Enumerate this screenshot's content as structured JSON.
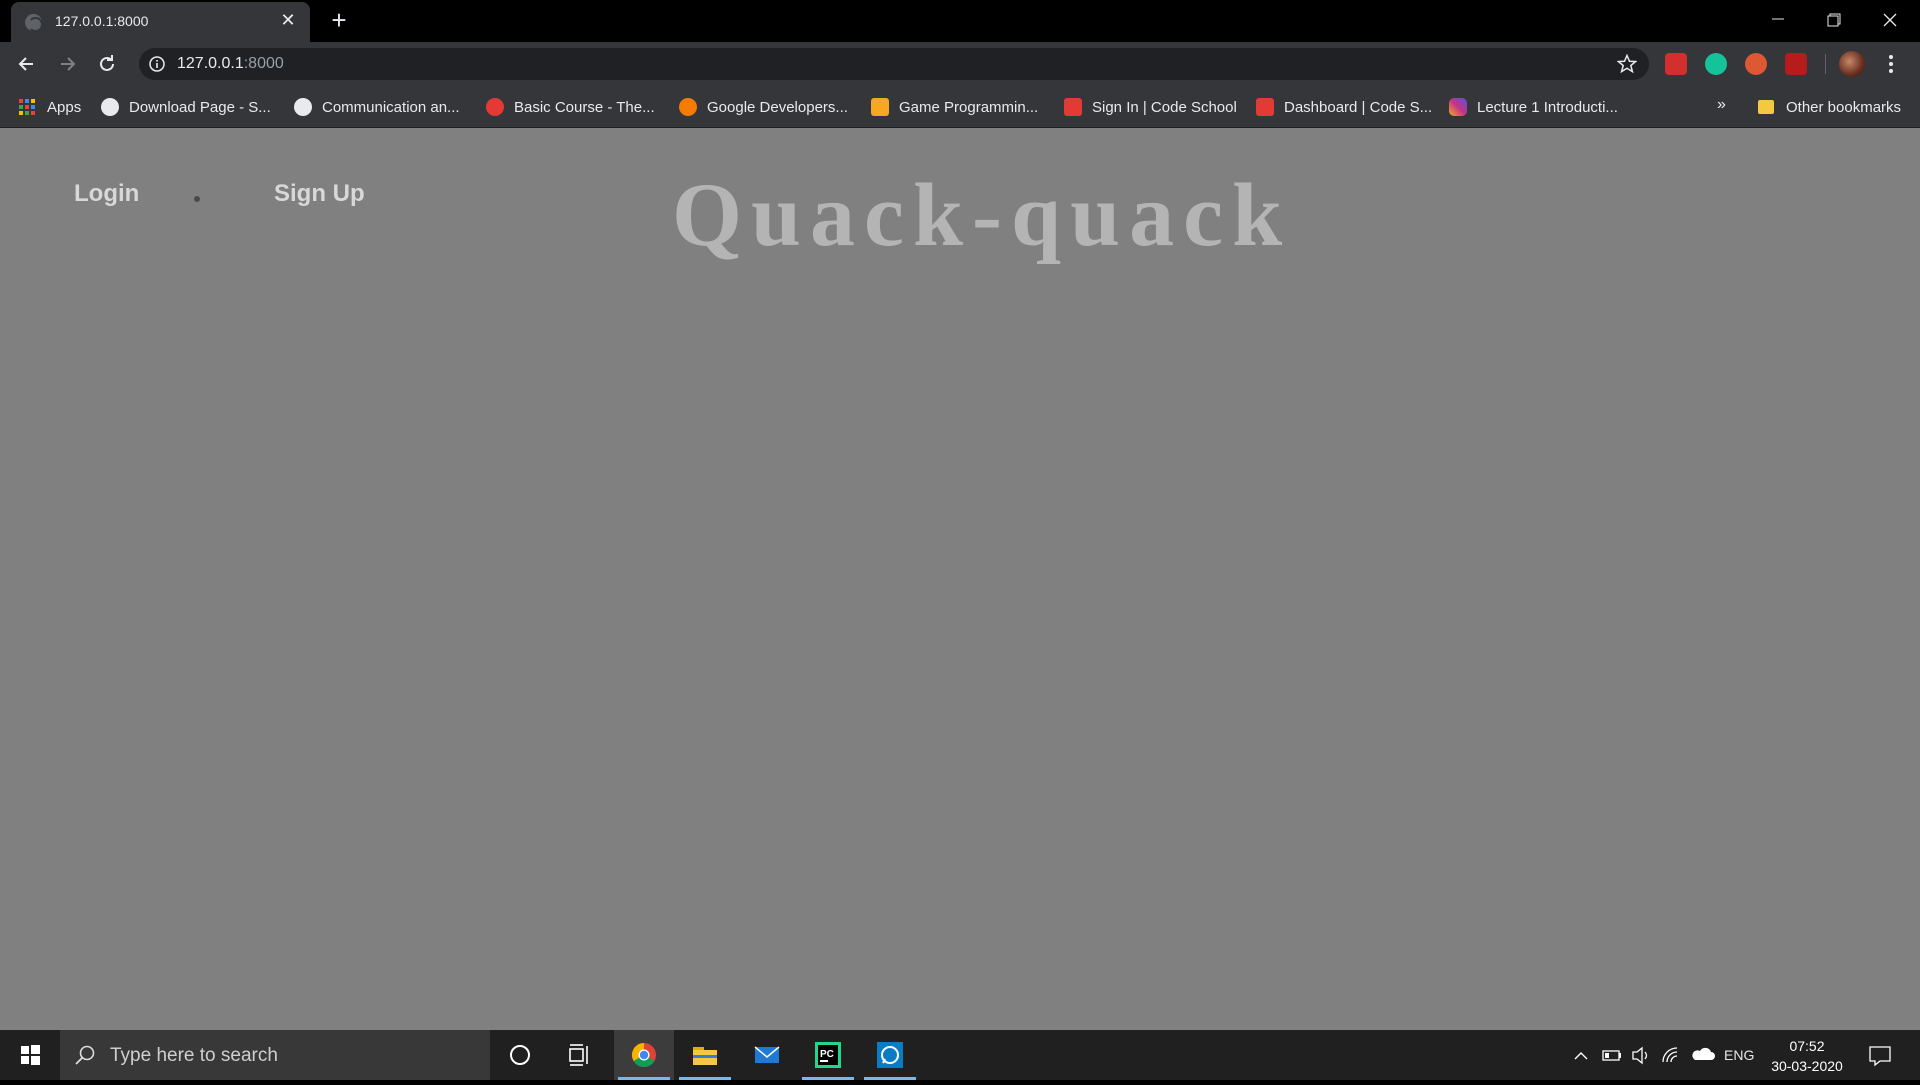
{
  "browser": {
    "tab": {
      "title": "127.0.0.1:8000",
      "close": "✕"
    },
    "new_tab": "+",
    "address": {
      "host": "127.0.0.1",
      "port": ":8000"
    },
    "bookmarks": [
      {
        "label": "Apps",
        "icon": "apps-grid-icon"
      },
      {
        "label": "Download Page - S...",
        "icon": "globe-icon",
        "color": "#e8eaed"
      },
      {
        "label": "Communication an...",
        "icon": "globe-icon",
        "color": "#e8eaed"
      },
      {
        "label": "Basic Course - The...",
        "icon": "r-logo-icon",
        "color": "#e53935"
      },
      {
        "label": "Google Developers...",
        "icon": "badge-icon",
        "color": "#f57c00"
      },
      {
        "label": "Game Programmin...",
        "icon": "game-icon",
        "color": "#f6a821"
      },
      {
        "label": "Sign In | Code School",
        "icon": "mail-icon",
        "color": "#e53935"
      },
      {
        "label": "Dashboard | Code S...",
        "icon": "mail-icon",
        "color": "#e53935"
      },
      {
        "label": "Lecture 1 Introducti...",
        "icon": "instagram-icon",
        "color": "#c13584"
      }
    ],
    "overflow": "»",
    "other_bookmarks": "Other bookmarks"
  },
  "page": {
    "nav": {
      "login": "Login",
      "signup": "Sign Up"
    },
    "title": "Quack-quack"
  },
  "taskbar": {
    "search_placeholder": "Type here to search",
    "language": "ENG",
    "time": "07:52",
    "date": "30-03-2020"
  },
  "colors": {
    "page_bg": "#808080",
    "title": "#b4b4b4",
    "nav_text": "#d8d8d8"
  }
}
